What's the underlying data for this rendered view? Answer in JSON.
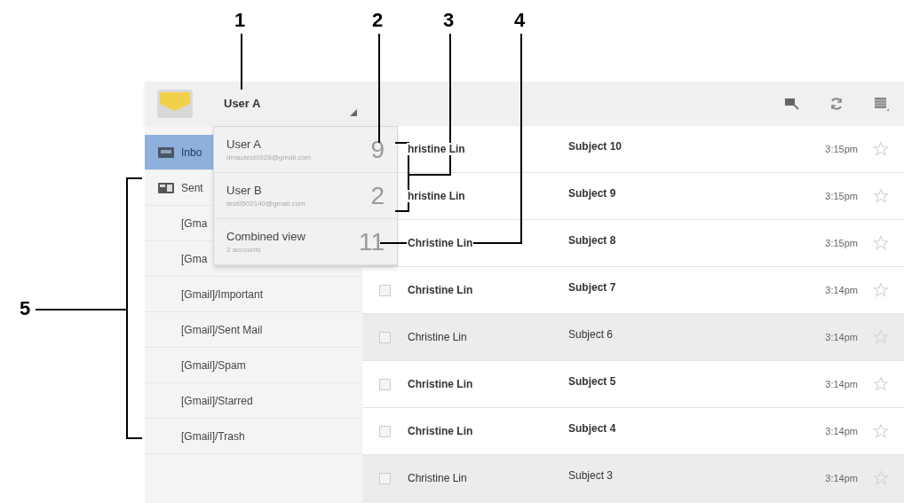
{
  "callouts": [
    {
      "label": "1"
    },
    {
      "label": "2"
    },
    {
      "label": "3"
    },
    {
      "label": "4"
    },
    {
      "label": "5"
    }
  ],
  "account_menu": {
    "current": "User A",
    "accounts": [
      {
        "name": "User A",
        "detail": "dmautest0928@gmail.com",
        "count": "9"
      },
      {
        "name": "User B",
        "detail": "test0502140@gmail.com",
        "count": "2"
      },
      {
        "name": "Combined view",
        "detail": "2 accounts",
        "count": "11"
      }
    ]
  },
  "sidebar": {
    "items": [
      {
        "label": "Inbo",
        "kind": "inbox",
        "selected": true
      },
      {
        "label": "Sent",
        "kind": "sent",
        "selected": false
      },
      {
        "label": "[Gma",
        "kind": "label",
        "selected": false
      },
      {
        "label": "[Gma",
        "kind": "label",
        "selected": false
      },
      {
        "label": "[Gmail]/Important",
        "kind": "label",
        "selected": false
      },
      {
        "label": "[Gmail]/Sent Mail",
        "kind": "label",
        "selected": false
      },
      {
        "label": "[Gmail]/Spam",
        "kind": "label",
        "selected": false
      },
      {
        "label": "[Gmail]/Starred",
        "kind": "label",
        "selected": false
      },
      {
        "label": "[Gmail]/Trash",
        "kind": "label",
        "selected": false
      }
    ]
  },
  "messages": [
    {
      "sender": "hristine Lin",
      "subject": "Subject 10",
      "time": "3:15pm",
      "unread": true,
      "starred": false
    },
    {
      "sender": "hristine Lin",
      "subject": "Subject 9",
      "time": "3:15pm",
      "unread": true,
      "starred": false
    },
    {
      "sender": "Christine Lin",
      "subject": "Subject 8",
      "time": "3:15pm",
      "unread": true,
      "starred": false
    },
    {
      "sender": "Christine Lin",
      "subject": "Subject 7",
      "time": "3:14pm",
      "unread": true,
      "starred": false,
      "checked": false
    },
    {
      "sender": "Christine Lin",
      "subject": "Subject 6",
      "time": "3:14pm",
      "unread": false,
      "starred": false,
      "checked": false
    },
    {
      "sender": "Christine Lin",
      "subject": "Subject 5",
      "time": "3:14pm",
      "unread": true,
      "starred": false,
      "checked": false
    },
    {
      "sender": "Christine Lin",
      "subject": "Subject 4",
      "time": "3:14pm",
      "unread": true,
      "starred": false,
      "checked": false
    },
    {
      "sender": "Christine Lin",
      "subject": "Subject 3",
      "time": "3:14pm",
      "unread": false,
      "starred": false,
      "checked": false
    }
  ]
}
